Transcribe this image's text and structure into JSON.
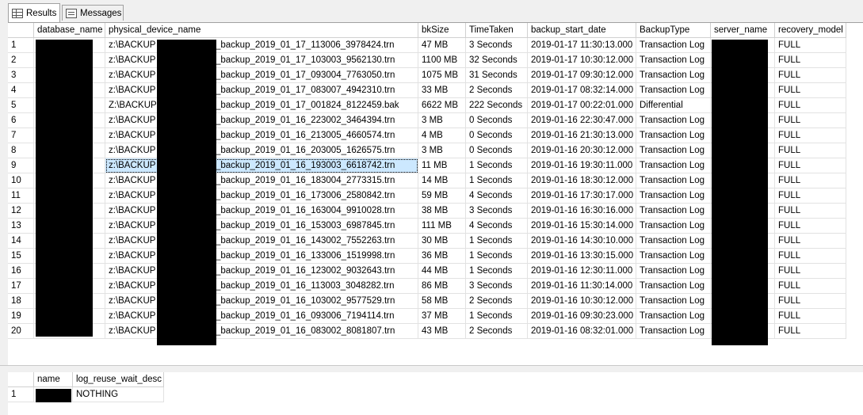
{
  "tabs": [
    {
      "label": "Results",
      "icon": "grid-icon",
      "active": true
    },
    {
      "label": "Messages",
      "icon": "messages-icon",
      "active": false
    }
  ],
  "results": {
    "columns": [
      "database_name",
      "physical_device_name",
      "bkSize",
      "TimeTaken",
      "backup_start_date",
      "BackupType",
      "server_name",
      "recovery_model"
    ],
    "selected_row": 9,
    "rows": [
      {
        "n": "1",
        "db": "",
        "path_prefix": "z:\\BACKUP",
        "path_suffix": "_backup_2019_01_17_113006_3978424.trn",
        "size": "47 MB",
        "time": "3 Seconds",
        "start": "2019-01-17 11:30:13.000",
        "type": "Transaction Log",
        "server": "",
        "model": "FULL"
      },
      {
        "n": "2",
        "db": "",
        "path_prefix": "z:\\BACKUP",
        "path_suffix": "_backup_2019_01_17_103003_9562130.trn",
        "size": "1100 MB",
        "time": "32 Seconds",
        "start": "2019-01-17 10:30:12.000",
        "type": "Transaction Log",
        "server": "",
        "model": "FULL"
      },
      {
        "n": "3",
        "db": "",
        "path_prefix": "z:\\BACKUP",
        "path_suffix": "_backup_2019_01_17_093004_7763050.trn",
        "size": "1075 MB",
        "time": "31 Seconds",
        "start": "2019-01-17 09:30:12.000",
        "type": "Transaction Log",
        "server": "",
        "model": "FULL"
      },
      {
        "n": "4",
        "db": "",
        "path_prefix": "z:\\BACKUP",
        "path_suffix": "_backup_2019_01_17_083007_4942310.trn",
        "size": "33 MB",
        "time": "2 Seconds",
        "start": "2019-01-17 08:32:14.000",
        "type": "Transaction Log",
        "server": "",
        "model": "FULL"
      },
      {
        "n": "5",
        "db": "",
        "path_prefix": "Z:\\BACKUP",
        "path_suffix": "_backup_2019_01_17_001824_8122459.bak",
        "size": "6622 MB",
        "time": "222 Seconds",
        "start": "2019-01-17 00:22:01.000",
        "type": "Differential",
        "server": "",
        "model": "FULL"
      },
      {
        "n": "6",
        "db": "",
        "path_prefix": "z:\\BACKUP",
        "path_suffix": "_backup_2019_01_16_223002_3464394.trn",
        "size": "3 MB",
        "time": "0 Seconds",
        "start": "2019-01-16 22:30:47.000",
        "type": "Transaction Log",
        "server": "",
        "model": "FULL"
      },
      {
        "n": "7",
        "db": "",
        "path_prefix": "z:\\BACKUP",
        "path_suffix": "_backup_2019_01_16_213005_4660574.trn",
        "size": "4 MB",
        "time": "0 Seconds",
        "start": "2019-01-16 21:30:13.000",
        "type": "Transaction Log",
        "server": "",
        "model": "FULL"
      },
      {
        "n": "8",
        "db": "",
        "path_prefix": "z:\\BACKUP",
        "path_suffix": "_backup_2019_01_16_203005_1626575.trn",
        "size": "3 MB",
        "time": "0 Seconds",
        "start": "2019-01-16 20:30:12.000",
        "type": "Transaction Log",
        "server": "",
        "model": "FULL"
      },
      {
        "n": "9",
        "db": "",
        "path_prefix": "z:\\BACKUP",
        "path_suffix": "_backup_2019_01_16_193003_6618742.trn",
        "size": "11 MB",
        "time": "1 Seconds",
        "start": "2019-01-16 19:30:11.000",
        "type": "Transaction Log",
        "server": "",
        "model": "FULL"
      },
      {
        "n": "10",
        "db": "",
        "path_prefix": "z:\\BACKUP",
        "path_suffix": "_backup_2019_01_16_183004_2773315.trn",
        "size": "14 MB",
        "time": "1 Seconds",
        "start": "2019-01-16 18:30:12.000",
        "type": "Transaction Log",
        "server": "",
        "model": "FULL"
      },
      {
        "n": "11",
        "db": "",
        "path_prefix": "z:\\BACKUP",
        "path_suffix": "_backup_2019_01_16_173006_2580842.trn",
        "size": "59 MB",
        "time": "4 Seconds",
        "start": "2019-01-16 17:30:17.000",
        "type": "Transaction Log",
        "server": "",
        "model": "FULL"
      },
      {
        "n": "12",
        "db": "",
        "path_prefix": "z:\\BACKUP",
        "path_suffix": "_backup_2019_01_16_163004_9910028.trn",
        "size": "38 MB",
        "time": "3 Seconds",
        "start": "2019-01-16 16:30:16.000",
        "type": "Transaction Log",
        "server": "",
        "model": "FULL"
      },
      {
        "n": "13",
        "db": "",
        "path_prefix": "z:\\BACKUP",
        "path_suffix": "_backup_2019_01_16_153003_6987845.trn",
        "size": "111 MB",
        "time": "4 Seconds",
        "start": "2019-01-16 15:30:14.000",
        "type": "Transaction Log",
        "server": "",
        "model": "FULL"
      },
      {
        "n": "14",
        "db": "",
        "path_prefix": "z:\\BACKUP",
        "path_suffix": "_backup_2019_01_16_143002_7552263.trn",
        "size": "30 MB",
        "time": "1 Seconds",
        "start": "2019-01-16 14:30:10.000",
        "type": "Transaction Log",
        "server": "",
        "model": "FULL"
      },
      {
        "n": "15",
        "db": "",
        "path_prefix": "z:\\BACKUP",
        "path_suffix": "_backup_2019_01_16_133006_1519998.trn",
        "size": "36 MB",
        "time": "1 Seconds",
        "start": "2019-01-16 13:30:15.000",
        "type": "Transaction Log",
        "server": "",
        "model": "FULL"
      },
      {
        "n": "16",
        "db": "",
        "path_prefix": "z:\\BACKUP",
        "path_suffix": "_backup_2019_01_16_123002_9032643.trn",
        "size": "44 MB",
        "time": "1 Seconds",
        "start": "2019-01-16 12:30:11.000",
        "type": "Transaction Log",
        "server": "",
        "model": "FULL"
      },
      {
        "n": "17",
        "db": "",
        "path_prefix": "z:\\BACKUP",
        "path_suffix": "_backup_2019_01_16_113003_3048282.trn",
        "size": "86 MB",
        "time": "3 Seconds",
        "start": "2019-01-16 11:30:14.000",
        "type": "Transaction Log",
        "server": "",
        "model": "FULL"
      },
      {
        "n": "18",
        "db": "",
        "path_prefix": "z:\\BACKUP",
        "path_suffix": "_backup_2019_01_16_103002_9577529.trn",
        "size": "58 MB",
        "time": "2 Seconds",
        "start": "2019-01-16 10:30:12.000",
        "type": "Transaction Log",
        "server": "",
        "model": "FULL"
      },
      {
        "n": "19",
        "db": "",
        "path_prefix": "z:\\BACKUP",
        "path_suffix": "_backup_2019_01_16_093006_7194114.trn",
        "size": "37 MB",
        "time": "1 Seconds",
        "start": "2019-01-16 09:30:23.000",
        "type": "Transaction Log",
        "server": "",
        "model": "FULL"
      },
      {
        "n": "20",
        "db": "",
        "path_prefix": "z:\\BACKUP",
        "path_suffix": "_backup_2019_01_16_083002_8081807.trn",
        "size": "43 MB",
        "time": "2 Seconds",
        "start": "2019-01-16 08:32:01.000",
        "type": "Transaction Log",
        "server": "",
        "model": "FULL"
      }
    ]
  },
  "log_reuse": {
    "columns": [
      "name",
      "log_reuse_wait_desc"
    ],
    "rows": [
      {
        "n": "1",
        "name": "",
        "desc": "NOTHING"
      }
    ]
  },
  "colors": {
    "selection": "#cce8ff",
    "redaction": "#000000",
    "grid_line": "#e2e2e2"
  }
}
